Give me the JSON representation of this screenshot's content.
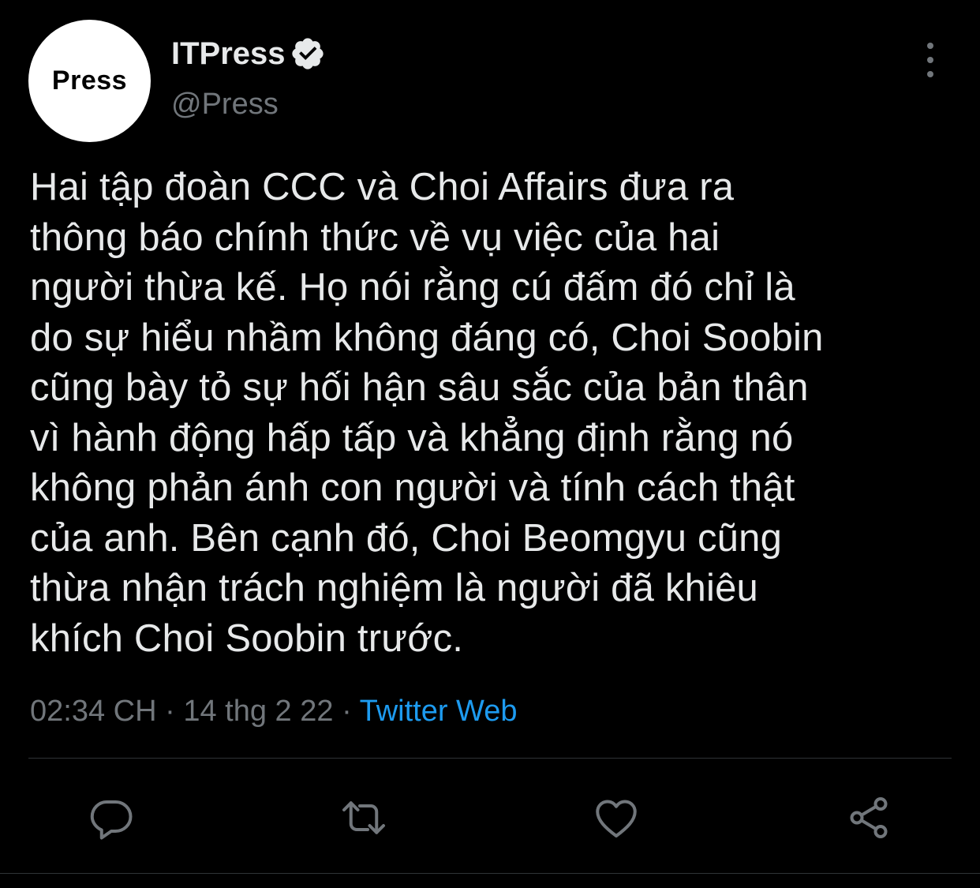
{
  "account": {
    "avatar_text": "Press",
    "display_name": "ITPress",
    "handle": "@Press",
    "verified": true
  },
  "tweet": {
    "text": "Hai tập đoàn CCC và Choi Affairs đưa ra\nthông báo chính thức về vụ việc của hai\nngười thừa kế. Họ nói rằng cú đấm đó chỉ là\ndo sự hiểu nhầm không đáng có, Choi Soobin\ncũng bày tỏ sự hối hận sâu sắc của bản thân\nvì hành động hấp tấp và khẳng định rằng nó\nkhông phản ánh con người và tính cách thật\ncủa anh. Bên cạnh đó, Choi Beomgyu cũng\nthừa nhận trách nghiệm là người đã khiêu\nkhích Choi Soobin trước.",
    "time": "02:34 CH",
    "separator": "·",
    "date": "14 thg 2 22",
    "source": "Twitter Web"
  },
  "actions": {
    "icons": [
      "reply-icon",
      "retweet-icon",
      "like-icon",
      "share-icon"
    ]
  },
  "colors": {
    "background": "#000000",
    "text": "#e7e9ea",
    "muted": "#71767b",
    "accent": "#1d9bf0",
    "divider": "#2f3336"
  }
}
